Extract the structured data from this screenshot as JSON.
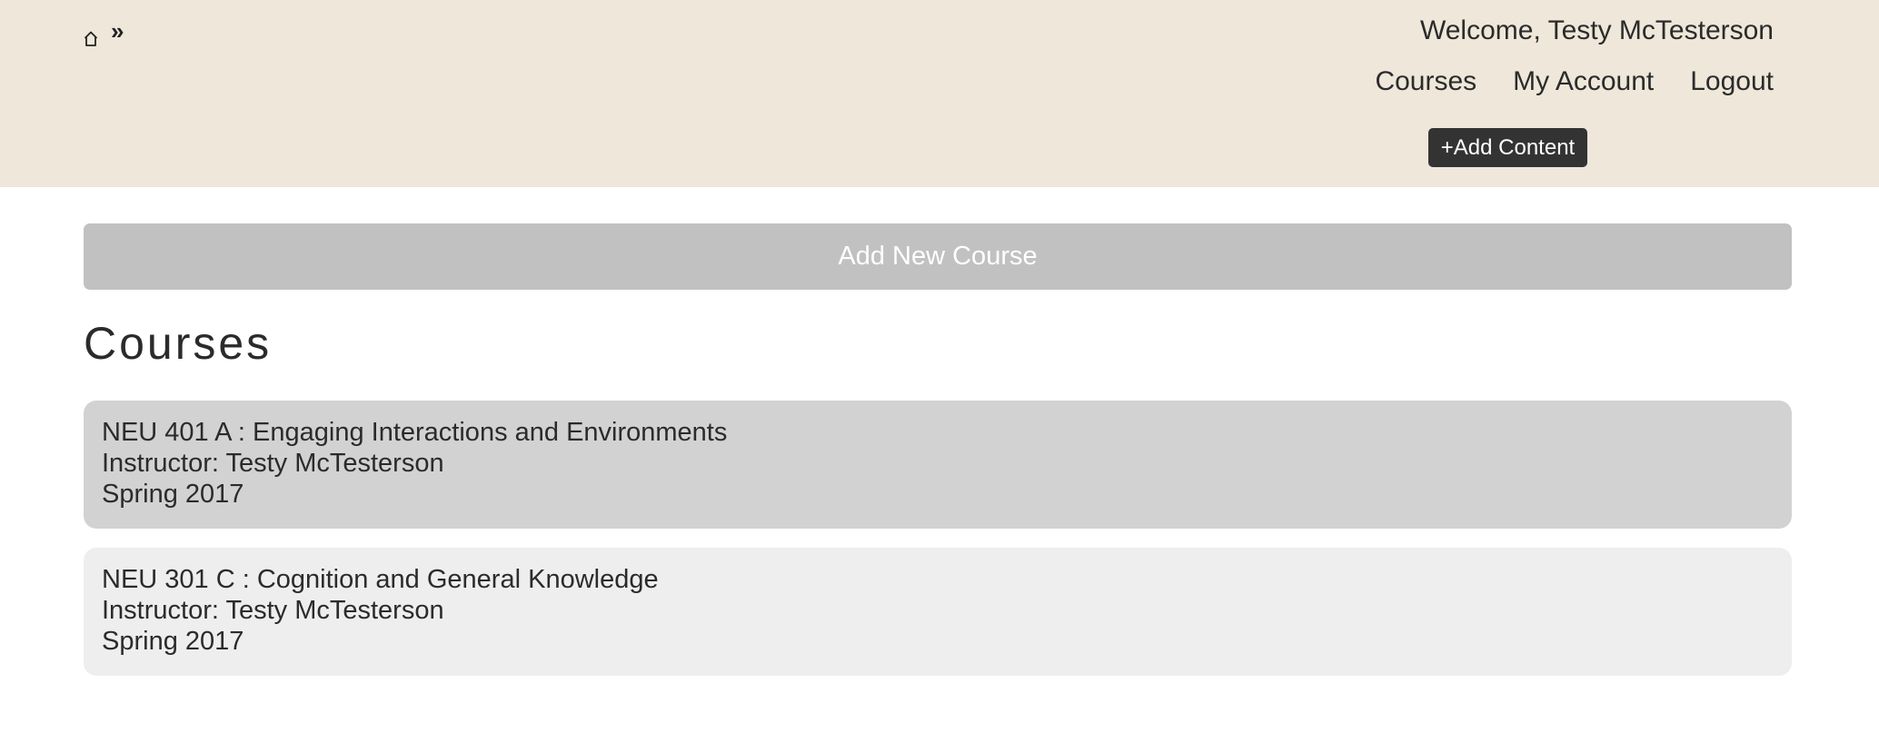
{
  "breadcrumb": {
    "home_icon": "home-icon",
    "separator": "»"
  },
  "header": {
    "welcome": "Welcome, Testy McTesterson",
    "nav": [
      {
        "label": "Courses"
      },
      {
        "label": "My Account"
      },
      {
        "label": "Logout"
      }
    ],
    "add_content_label": "+Add Content"
  },
  "main": {
    "add_course_label": "Add New Course",
    "heading": "Courses",
    "courses": [
      {
        "title": "NEU 401 A : Engaging Interactions and Environments",
        "instructor": "Instructor: Testy McTesterson",
        "term": "Spring 2017"
      },
      {
        "title": "NEU 301 C : Cognition and General Knowledge",
        "instructor": "Instructor: Testy McTesterson",
        "term": "Spring 2017"
      }
    ]
  },
  "colors": {
    "header_bg": "#eee7da",
    "add_content_bg": "#333333",
    "add_course_bg": "#c1c1c1",
    "course_active_bg": "#d2d2d2",
    "course_bg": "#eeeeee"
  }
}
